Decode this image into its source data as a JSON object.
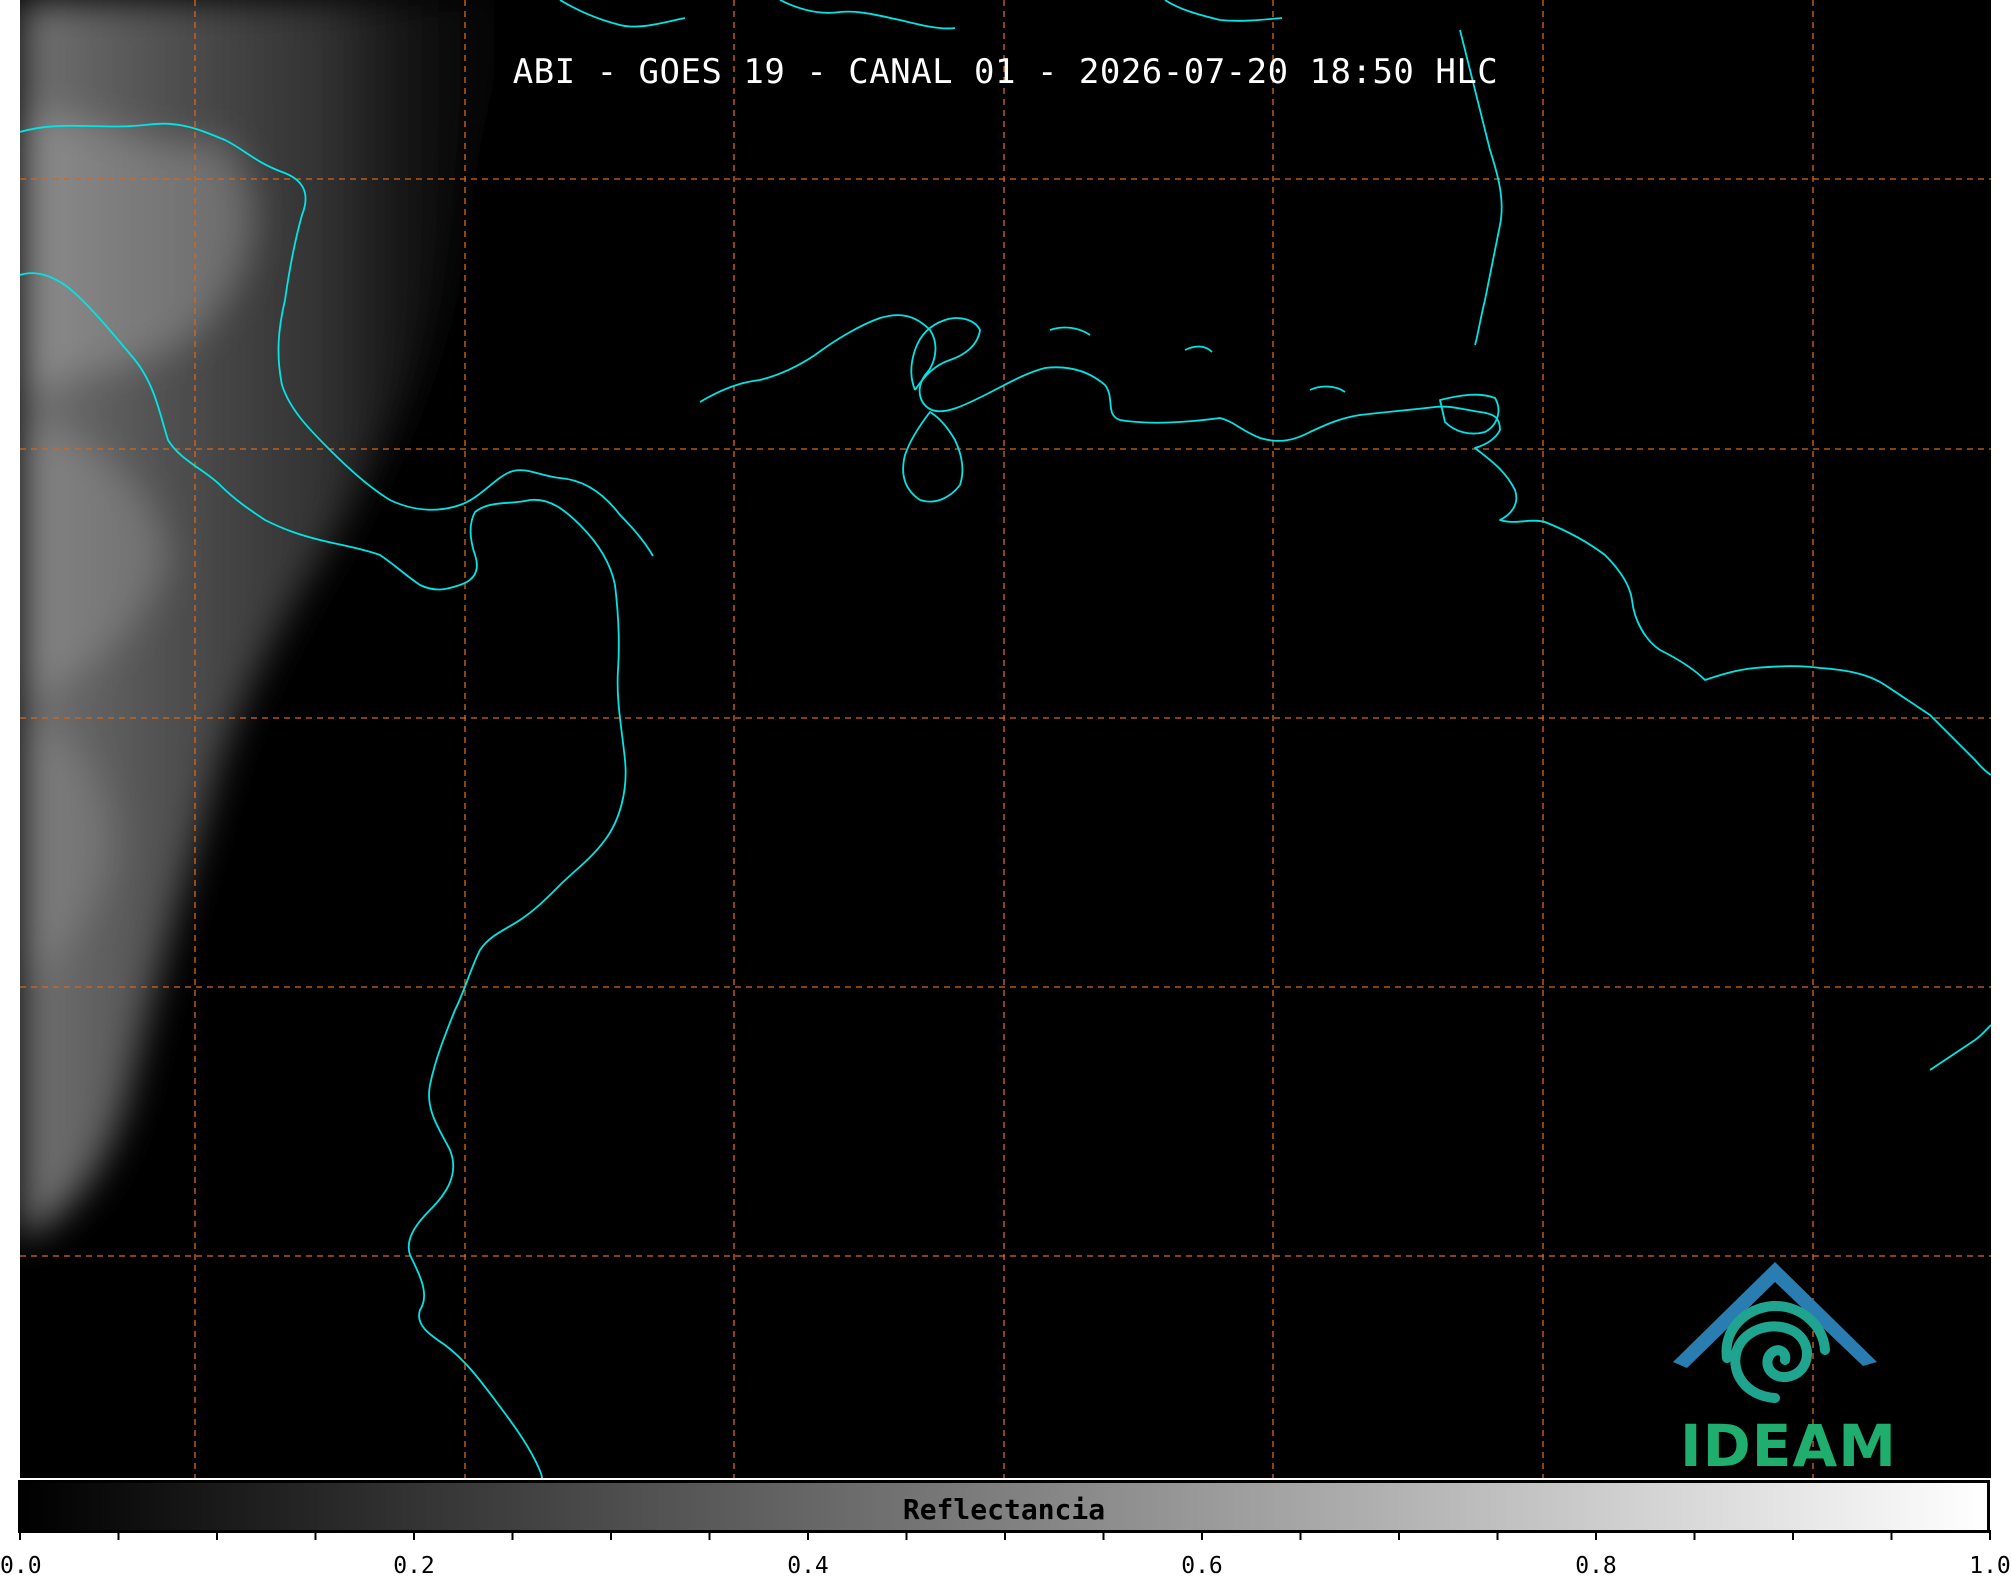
{
  "title": "ABI - GOES 19 - CANAL 01 - 2026-07-20 18:50 HLC",
  "colorbar": {
    "label": "Reflectancia",
    "range": [
      0.0,
      1.0
    ],
    "ticks": [
      "0.0",
      "0.2",
      "0.4",
      "0.6",
      "0.8",
      "1.0"
    ],
    "minor_tick_step": 0.05,
    "gradient_colors": [
      "#000000",
      "#ffffff"
    ]
  },
  "logo": {
    "text": "IDEAM",
    "colors": {
      "roof": "#2a7db0",
      "swirl": "#1fa58f",
      "text": "#1fae6e"
    }
  },
  "map": {
    "background": "#000000",
    "coastline_color": "#00e5e5",
    "gridline_color": "#d2691e",
    "gridline_style": "dashed",
    "cloud_color": "#bdbdbd"
  }
}
